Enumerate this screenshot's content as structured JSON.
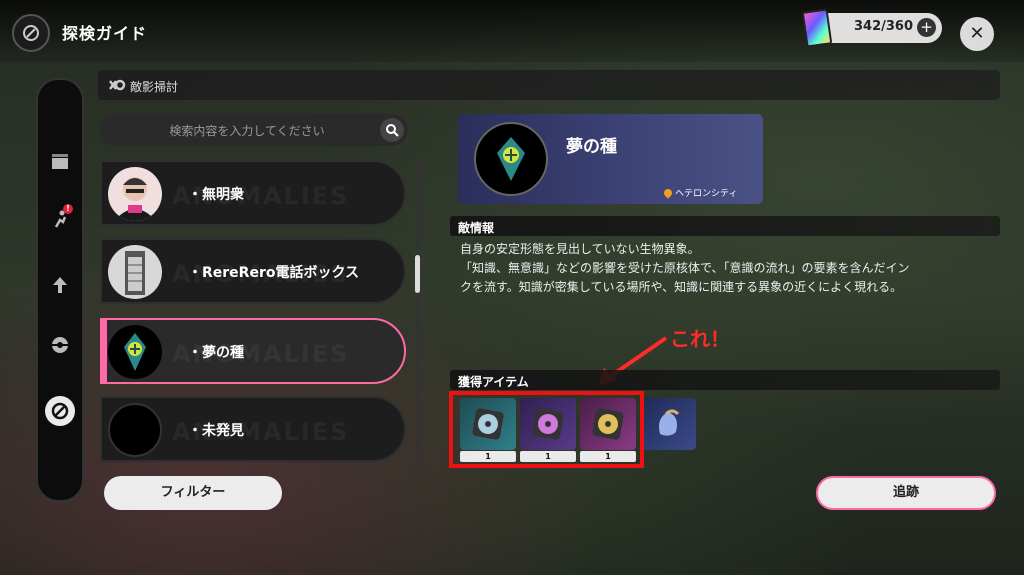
{
  "header": {
    "title": "探検ガイド"
  },
  "currency": {
    "count": "342/360"
  },
  "section": {
    "title": "敵影掃討"
  },
  "search": {
    "placeholder": "検索内容を入力してください"
  },
  "list": {
    "watermark": "ANOMALIES",
    "items": [
      {
        "label": "・無明衆"
      },
      {
        "label": "・RereRero電話ボックス"
      },
      {
        "label": "・夢の種"
      },
      {
        "label": "・未発見"
      }
    ]
  },
  "filter": {
    "label": "フィルター"
  },
  "enemy": {
    "name": "夢の種",
    "location": "ヘテロンシティ",
    "info_header": "敵情報",
    "description": [
      "自身の安定形態を見出していない生物異象。",
      "「知識、無意識」などの影響を受けた原核体で、「意識の流れ」の要素を含んだイン",
      "クを流す。知識が密集している場所や、知識に関連する異象の近くによく現れる。"
    ]
  },
  "drops": {
    "header": "獲得アイテム",
    "items": [
      {
        "qty": "1",
        "color": "#2f7f8a"
      },
      {
        "qty": "1",
        "color": "#5a3a8a"
      },
      {
        "qty": "1",
        "color": "#8a3a86"
      },
      {
        "qty": "",
        "color": "#3a4a8a"
      }
    ]
  },
  "annotation": {
    "text": "これ！"
  },
  "track": {
    "label": "追跡"
  },
  "colors": {
    "accent": "#ff6aa6",
    "highlight": "#ee1111"
  }
}
